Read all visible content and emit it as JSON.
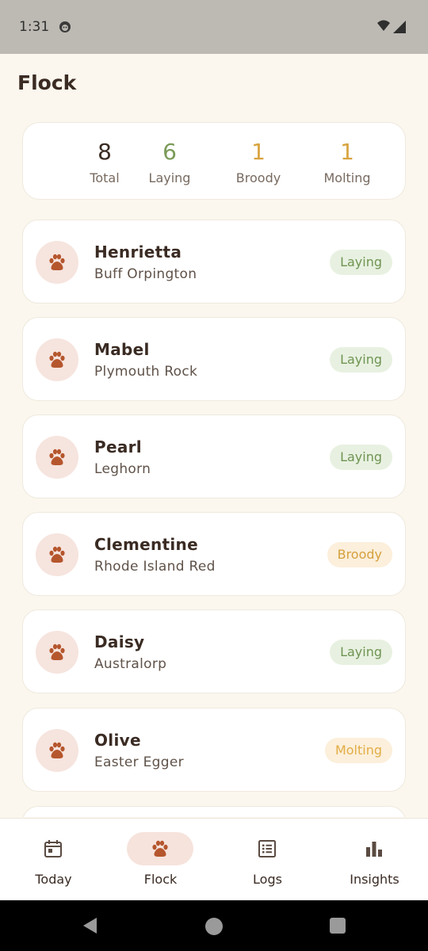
{
  "status_bar": {
    "time": "1:31"
  },
  "page": {
    "title": "Flock"
  },
  "summary": [
    {
      "value": "8",
      "label": "Total",
      "color": "#3a2b23"
    },
    {
      "value": "6",
      "label": "Laying",
      "color": "#7a9b58"
    },
    {
      "value": "1",
      "label": "Broody",
      "color": "#d8a33f"
    },
    {
      "value": "1",
      "label": "Molting",
      "color": "#d8a33f"
    }
  ],
  "hens": [
    {
      "name": "Henrietta",
      "breed": "Buff Orpington",
      "status": "Laying"
    },
    {
      "name": "Mabel",
      "breed": "Plymouth Rock",
      "status": "Laying"
    },
    {
      "name": "Pearl",
      "breed": "Leghorn",
      "status": "Laying"
    },
    {
      "name": "Clementine",
      "breed": "Rhode Island Red",
      "status": "Broody"
    },
    {
      "name": "Daisy",
      "breed": "Australorp",
      "status": "Laying"
    },
    {
      "name": "Olive",
      "breed": "Easter Egger",
      "status": "Molting"
    }
  ],
  "status_colors": {
    "Laying": {
      "bg": "#e8f1e1",
      "fg": "#6f9452"
    },
    "Broody": {
      "bg": "#fcefdb",
      "fg": "#d5a03c"
    },
    "Molting": {
      "bg": "#fcefdb",
      "fg": "#e2ad45"
    }
  },
  "bottom_nav": [
    {
      "label": "Today",
      "icon": "calendar-icon",
      "active": false
    },
    {
      "label": "Flock",
      "icon": "paw-icon",
      "active": true
    },
    {
      "label": "Logs",
      "icon": "list-icon",
      "active": false
    },
    {
      "label": "Insights",
      "icon": "bar-chart-icon",
      "active": false
    }
  ],
  "accent_color": "#b5562d"
}
